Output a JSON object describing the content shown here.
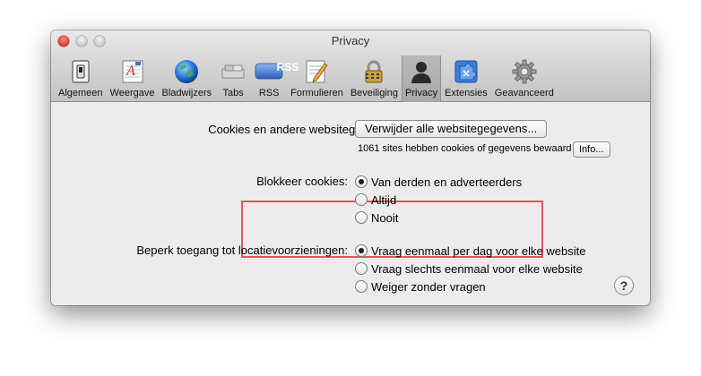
{
  "window": {
    "title": "Privacy"
  },
  "toolbar": {
    "items": [
      {
        "label": "Algemeen",
        "icon": "general-switch-icon"
      },
      {
        "label": "Weergave",
        "icon": "appearance-icon"
      },
      {
        "label": "Bladwijzers",
        "icon": "globe-icon"
      },
      {
        "label": "Tabs",
        "icon": "tabs-icon"
      },
      {
        "label": "RSS",
        "icon": "rss-icon"
      },
      {
        "label": "Formulieren",
        "icon": "autofill-pencil-icon"
      },
      {
        "label": "Beveiliging",
        "icon": "padlock-icon"
      },
      {
        "label": "Privacy",
        "icon": "privacy-silhouette-icon",
        "selected": true
      },
      {
        "label": "Extensies",
        "icon": "extensions-puzzle-icon"
      },
      {
        "label": "Geavanceerd",
        "icon": "gear-icon"
      }
    ],
    "rss_badge": "RSS"
  },
  "cookies": {
    "label": "Cookies en andere websitegegevens:",
    "remove_all_button": "Verwijder alle websitegegevens...",
    "summary": "1061 sites hebben cookies of gegevens bewaard",
    "info_button": "Info..."
  },
  "block_cookies": {
    "label": "Blokkeer cookies:",
    "options": [
      {
        "label": "Van derden en adverteerders",
        "checked": true
      },
      {
        "label": "Altijd",
        "checked": false
      },
      {
        "label": "Nooit",
        "checked": false
      }
    ]
  },
  "location": {
    "label": "Beperk toegang tot locatievoorzieningen:",
    "options": [
      {
        "label": "Vraag eenmaal per dag voor elke website",
        "checked": true
      },
      {
        "label": "Vraag slechts eenmaal voor elke website",
        "checked": false
      },
      {
        "label": "Weiger zonder vragen",
        "checked": false
      }
    ]
  },
  "help_button": "?",
  "colors": {
    "highlight": "#e5535b",
    "window_bg": "#ececec"
  }
}
